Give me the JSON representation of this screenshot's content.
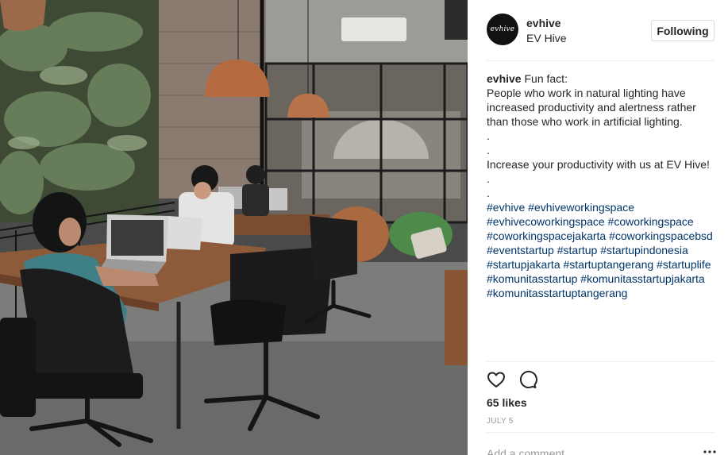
{
  "post": {
    "photo_icon": "coworking-photo",
    "header": {
      "avatar_text": "evhive",
      "username": "evhive",
      "full_name": "EV Hive",
      "follow_label": "Following"
    },
    "caption": {
      "username": "evhive",
      "lines": [
        "Fun fact:",
        "People who work in natural lighting have",
        "increased productivity and alertness rather",
        "than those who work in artificial lighting.",
        ".",
        ".",
        "Increase your productivity with us at EV Hive!",
        ".",
        "."
      ],
      "hashtags": [
        "#evhive",
        "#evhiveworkingspace",
        "#evhivecoworkingspace",
        "#coworkingspace",
        "#coworkingspacejakarta",
        "#coworkingspacebsd",
        "#eventstartup",
        "#startup",
        "#startupindonesia",
        "#startupjakarta",
        "#startuptangerang",
        "#startuplife",
        "#komunitasstartup",
        "#komunitasstartupjakarta",
        "#komunitasstartuptangerang"
      ]
    },
    "actions": {
      "like_icon": "heart-icon",
      "comment_icon": "comment-icon"
    },
    "likes": "65 likes",
    "date": "JULY 5",
    "comment_placeholder": "Add a comment...",
    "more_icon": "more-icon",
    "colors": {
      "link": "#003569",
      "muted": "#999999",
      "border": "#efefef"
    }
  }
}
